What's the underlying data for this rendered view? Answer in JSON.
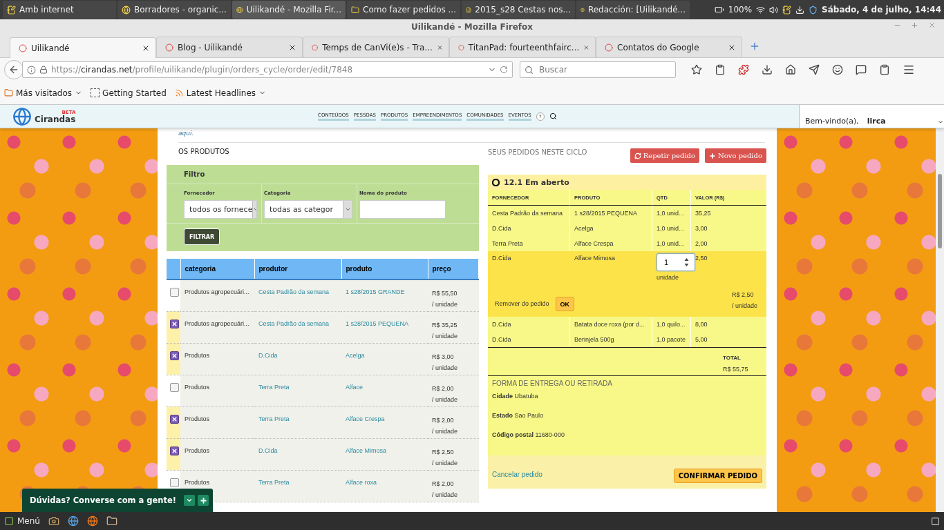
{
  "top_panel": {
    "tasks": [
      {
        "label": "Amb internet",
        "selected": false
      },
      {
        "label": "Borradores - organic...",
        "selected": false
      },
      {
        "label": "Uilikandé - Mozilla Fir...",
        "selected": true
      },
      {
        "label": "Como fazer pedidos ...",
        "selected": false
      },
      {
        "label": "2015_s28 Cestas nos...",
        "selected": false
      },
      {
        "label": "Redacción: [Uilikandé...",
        "selected": false
      }
    ],
    "battery": "100%",
    "clock": "Sábado, 4 de julho, 14:44"
  },
  "window": {
    "title": "Uilikandé - Mozilla Firefox"
  },
  "tabs": [
    {
      "label": "Uilikandé",
      "selected": true
    },
    {
      "label": "Blog - Uilikandé",
      "selected": false
    },
    {
      "label": "Temps de CanVi(e)s - Tra...",
      "selected": false
    },
    {
      "label": "TitanPad: fourteenthfairc...",
      "selected": false
    },
    {
      "label": "Contatos do Google",
      "selected": false
    }
  ],
  "address": {
    "scheme": "https://",
    "domain": "cirandas.net",
    "path": "/profile/uilikande/plugin/orders_cycle/order/edit/7848"
  },
  "search": {
    "placeholder": "Buscar"
  },
  "bookmarks": [
    {
      "label": "Más visitados",
      "dropdown": true
    },
    {
      "label": "Getting Started",
      "dropdown": false
    },
    {
      "label": "Latest Headlines",
      "dropdown": true
    }
  ],
  "site": {
    "logo": "Cirandas",
    "logo_badge": "BETA",
    "nav": [
      "CONTEÚDOS",
      "PESSOAS",
      "PRODUTOS",
      "EMPREENDIMENTOS",
      "COMUNIDADES",
      "EVENTOS"
    ],
    "help": "?",
    "welcome": "Bem-vindo(a),",
    "user": "lirca"
  },
  "intro_link": "aqui.",
  "products": {
    "heading": "OS PRODUTOS",
    "filter": {
      "title": "Filtro",
      "fields": [
        {
          "label": "Fornecedor",
          "kind": "select",
          "value": "todos os fornece"
        },
        {
          "label": "Categoria",
          "kind": "select",
          "value": "todas as categor"
        },
        {
          "label": "Nome do produto",
          "kind": "text"
        }
      ],
      "button": "FILTRAR"
    },
    "columns": [
      "categoria",
      "produtor",
      "produto",
      "preço"
    ],
    "rows": [
      {
        "checked": false,
        "categoria": "Produtos agropecuári...",
        "produtor": "Cesta Padrão da semana",
        "produto": "1 s28/2015 GRANDE",
        "price": "R$ 55,50",
        "unit": "/ unidade"
      },
      {
        "checked": true,
        "categoria": "Produtos agropecuári...",
        "produtor": "Cesta Padrão da semana",
        "produto": "1 s28/2015 PEQUENA",
        "price": "R$ 35,25",
        "unit": "/ unidade"
      },
      {
        "checked": true,
        "categoria": "Produtos",
        "produtor": "D.Cida",
        "produto": "Acelga",
        "price": "R$ 3,00",
        "unit": "/ unidade"
      },
      {
        "checked": false,
        "categoria": "Produtos",
        "produtor": "Terra Preta",
        "produto": "Alface",
        "price": "R$ 2,00",
        "unit": "/ unidade"
      },
      {
        "checked": true,
        "categoria": "Produtos",
        "produtor": "Terra Preta",
        "produto": "Alface Crespa",
        "price": "R$ 2,00",
        "unit": "/ unidade"
      },
      {
        "checked": true,
        "categoria": "Produtos",
        "produtor": "D.Cida",
        "produto": "Alface Mimosa",
        "price": "R$ 2,50",
        "unit": "/ unidade"
      },
      {
        "checked": false,
        "categoria": "Produtos",
        "produtor": "Terra Preta",
        "produto": "Alface roxa",
        "price": "R$ 2,00",
        "unit": "/ unidade"
      }
    ]
  },
  "order": {
    "heading": "SEUS PEDIDOS NESTE CICLO",
    "buttons": [
      {
        "label": "Repetir pedido",
        "kind": "repeat"
      },
      {
        "label": "Novo pedido",
        "kind": "new"
      }
    ],
    "title": "12.1 Em aberto",
    "columns": [
      "FORNECEDOR",
      "PRODUTO",
      "QTD",
      "VALOR (R$)"
    ],
    "rows": [
      {
        "kind": "item",
        "fornecedor": "Cesta Padrão da semana",
        "produto": "1 s28/2015 PEQUENA",
        "qtd": "1,0 unid...",
        "valor": "35,25"
      },
      {
        "kind": "item",
        "fornecedor": "D.Cida",
        "produto": "Acelga",
        "qtd": "1,0 unid...",
        "valor": "3,00"
      },
      {
        "kind": "item",
        "fornecedor": "Terra Preta",
        "produto": "Alface Crespa",
        "qtd": "1,0 unid...",
        "valor": "2,00"
      },
      {
        "kind": "editing",
        "fornecedor": "D.Cida",
        "produto": "Alface Mimosa",
        "quantity": "1",
        "unit": "unidade",
        "valor": "2,50",
        "remove": "Remover do pedido",
        "ok": "OK",
        "price": "R$ 2,50",
        "price_unit": "/ unidade"
      },
      {
        "kind": "item",
        "fornecedor": "D.Cida",
        "produto": "Batata doce roxa (por d...",
        "qtd": "1,0 quilo...",
        "valor": "8,00"
      },
      {
        "kind": "item",
        "fornecedor": "D.Cida",
        "produto": "Berinjela 500g",
        "qtd": "1,0 pacote",
        "valor": "5,00"
      }
    ],
    "total_label": "TOTAL",
    "total": "R$ 55,75",
    "delivery": {
      "heading": "FORMA DE ENTREGA OU RETIRADA",
      "fields": [
        {
          "label": "Cidade",
          "value": "Ubatuba"
        },
        {
          "label": "Estado",
          "value": "Sao Paulo"
        },
        {
          "label": "Código postal",
          "value": "11680-000"
        }
      ]
    },
    "cancel": "Cancelar pedido",
    "confirm": "CONFIRMAR PEDIDO"
  },
  "chat": {
    "label": "Dúvidas? Converse com a gente!"
  },
  "taskbar": {
    "menu": "Menú"
  }
}
